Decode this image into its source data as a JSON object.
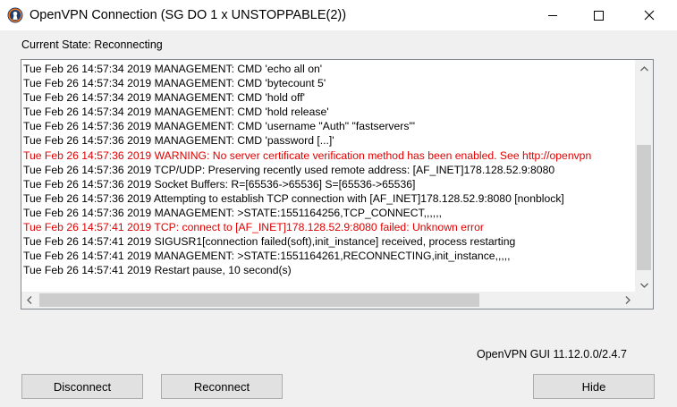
{
  "window": {
    "title": "OpenVPN Connection (SG DO 1 x UNSTOPPABLE(2))"
  },
  "status": {
    "current_state": "Current State: Reconnecting"
  },
  "log": {
    "lines": [
      {
        "text": "Tue Feb 26 14:57:34 2019 MANAGEMENT: CMD 'echo all on'",
        "level": "info"
      },
      {
        "text": "Tue Feb 26 14:57:34 2019 MANAGEMENT: CMD 'bytecount 5'",
        "level": "info"
      },
      {
        "text": "Tue Feb 26 14:57:34 2019 MANAGEMENT: CMD 'hold off'",
        "level": "info"
      },
      {
        "text": "Tue Feb 26 14:57:34 2019 MANAGEMENT: CMD 'hold release'",
        "level": "info"
      },
      {
        "text": "Tue Feb 26 14:57:36 2019 MANAGEMENT: CMD 'username \"Auth\" \"fastservers\"'",
        "level": "info"
      },
      {
        "text": "Tue Feb 26 14:57:36 2019 MANAGEMENT: CMD 'password [...]'",
        "level": "info"
      },
      {
        "text": "Tue Feb 26 14:57:36 2019 WARNING: No server certificate verification method has been enabled.  See http://openvpn",
        "level": "warning"
      },
      {
        "text": "Tue Feb 26 14:57:36 2019 TCP/UDP: Preserving recently used remote address: [AF_INET]178.128.52.9:8080",
        "level": "info"
      },
      {
        "text": "Tue Feb 26 14:57:36 2019 Socket Buffers: R=[65536->65536] S=[65536->65536]",
        "level": "info"
      },
      {
        "text": "Tue Feb 26 14:57:36 2019 Attempting to establish TCP connection with [AF_INET]178.128.52.9:8080 [nonblock]",
        "level": "info"
      },
      {
        "text": "Tue Feb 26 14:57:36 2019 MANAGEMENT: >STATE:1551164256,TCP_CONNECT,,,,,,",
        "level": "info"
      },
      {
        "text": "Tue Feb 26 14:57:41 2019 TCP: connect to [AF_INET]178.128.52.9:8080 failed: Unknown error",
        "level": "warning"
      },
      {
        "text": "Tue Feb 26 14:57:41 2019 SIGUSR1[connection failed(soft),init_instance] received, process restarting",
        "level": "info"
      },
      {
        "text": "Tue Feb 26 14:57:41 2019 MANAGEMENT: >STATE:1551164261,RECONNECTING,init_instance,,,,,",
        "level": "info"
      },
      {
        "text": "Tue Feb 26 14:57:41 2019 Restart pause, 10 second(s)",
        "level": "info"
      }
    ]
  },
  "footer": {
    "version": "OpenVPN GUI 11.12.0.0/2.4.7"
  },
  "buttons": {
    "disconnect": "Disconnect",
    "reconnect": "Reconnect",
    "hide": "Hide"
  },
  "icons": {
    "app": "openvpn-logo-icon",
    "minimize": "minimize-icon",
    "maximize": "maximize-icon",
    "close": "close-icon"
  },
  "colors": {
    "warning_text": "#e00000",
    "window_bg": "#f0f0f0",
    "log_bg": "#ffffff"
  }
}
